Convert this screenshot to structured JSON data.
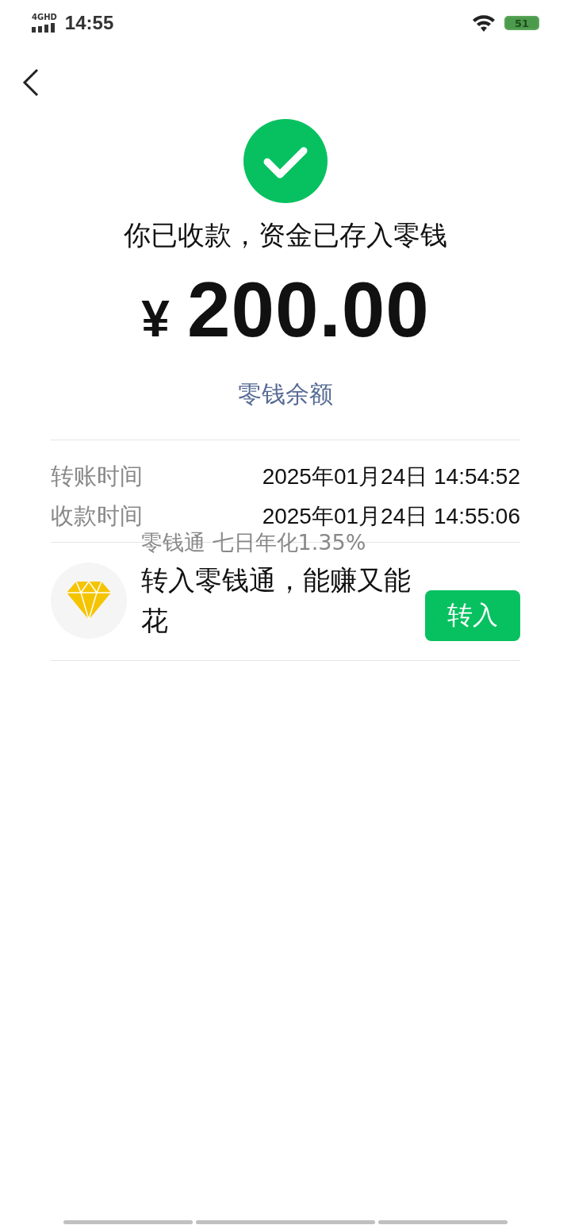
{
  "status_bar": {
    "network": "4GHD",
    "time": "14:55",
    "battery": "51"
  },
  "result": {
    "message": "你已收款，资金已存入零钱",
    "currency": "¥",
    "amount": "200.00",
    "link": "零钱余额"
  },
  "details": [
    {
      "label": "转账时间",
      "value": "2025年01月24日 14:54:52"
    },
    {
      "label": "收款时间",
      "value": "2025年01月24日 14:55:06"
    }
  ],
  "promo": {
    "subtitle": "零钱通 七日年化1.35%",
    "title": "转入零钱通，能赚又能花",
    "button": "转入"
  }
}
